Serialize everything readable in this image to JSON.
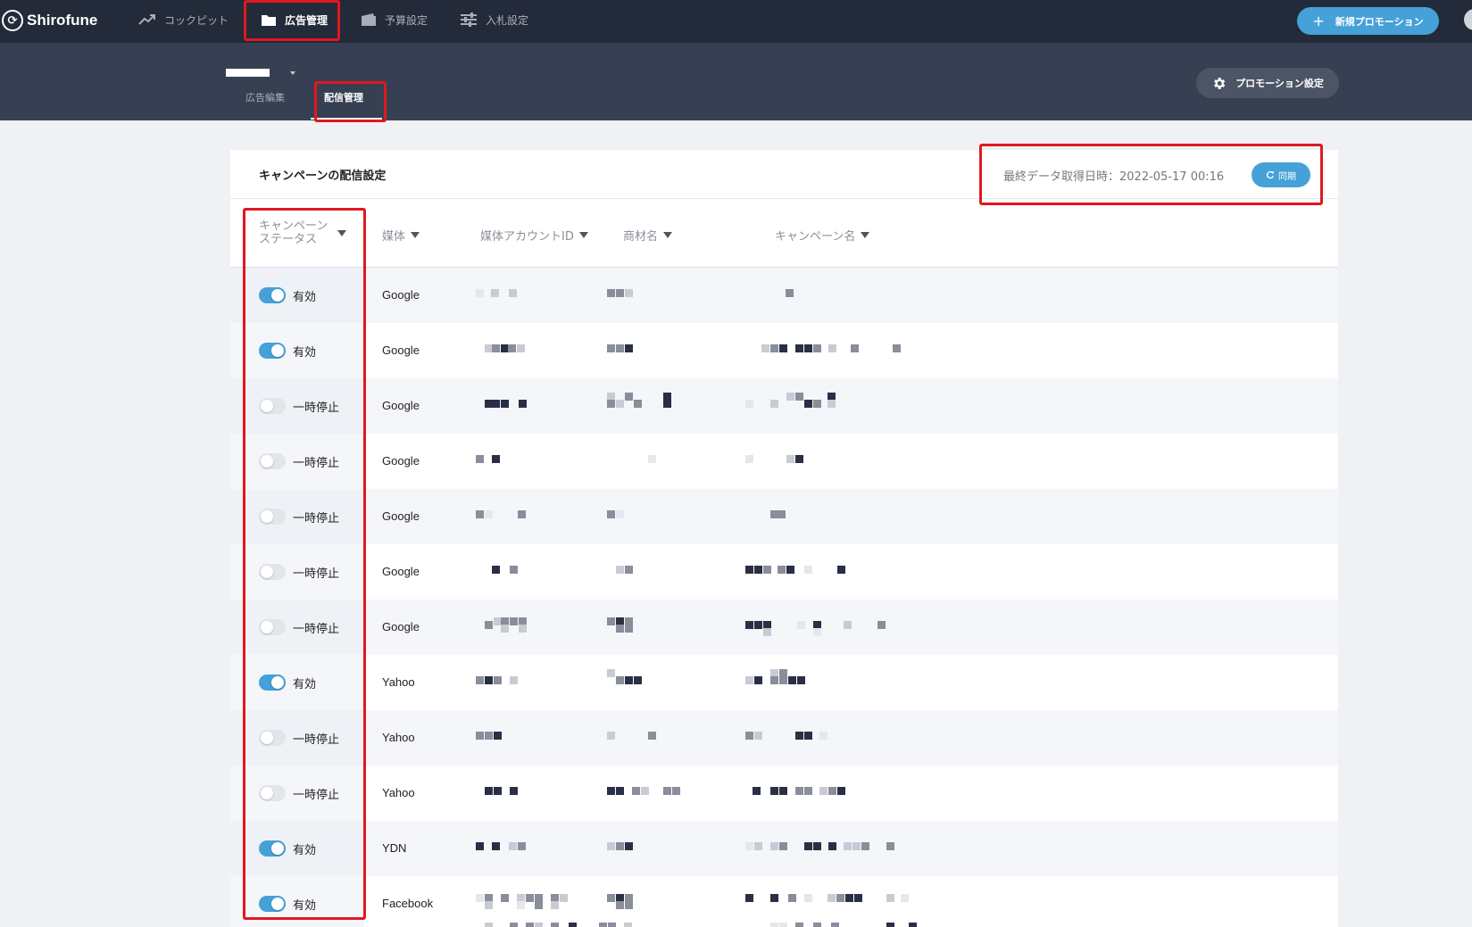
{
  "app": {
    "logo_text": "Shirofune"
  },
  "topnav": {
    "items": [
      {
        "label": "コックピット",
        "icon": "trend-icon"
      },
      {
        "label": "広告管理",
        "icon": "folder-icon",
        "active": true
      },
      {
        "label": "予算設定",
        "icon": "wallet-icon"
      },
      {
        "label": "入札設定",
        "icon": "sliders-icon"
      }
    ],
    "new_promotion": "新規プロモーション"
  },
  "subheader": {
    "tabs": [
      {
        "label": "広告編集"
      },
      {
        "label": "配信管理",
        "active": true
      }
    ],
    "promotion_settings": "プロモーション設定"
  },
  "card": {
    "title": "キャンペーンの配信設定",
    "last_fetch_label": "最終データ取得日時：",
    "last_fetch_value": "2022-05-17 00:16",
    "sync_label": "同期"
  },
  "table": {
    "columns": {
      "status_line1": "キャンペーン",
      "status_line2": "ステータス",
      "media": "媒体",
      "account_id": "媒体アカウントID",
      "product": "商材名",
      "campaign": "キャンペーン名"
    },
    "rows": [
      {
        "status": "有効",
        "on": true,
        "media": "Google"
      },
      {
        "status": "有効",
        "on": true,
        "media": "Google"
      },
      {
        "status": "一時停止",
        "on": false,
        "media": "Google"
      },
      {
        "status": "一時停止",
        "on": false,
        "media": "Google"
      },
      {
        "status": "一時停止",
        "on": false,
        "media": "Google"
      },
      {
        "status": "一時停止",
        "on": false,
        "media": "Google"
      },
      {
        "status": "一時停止",
        "on": false,
        "media": "Google"
      },
      {
        "status": "有効",
        "on": true,
        "media": "Yahoo"
      },
      {
        "status": "一時停止",
        "on": false,
        "media": "Yahoo"
      },
      {
        "status": "一時停止",
        "on": false,
        "media": "Yahoo"
      },
      {
        "status": "有効",
        "on": true,
        "media": "YDN"
      },
      {
        "status": "有効",
        "on": true,
        "media": "Facebook"
      }
    ]
  },
  "colors": {
    "nav_bg": "#232a3a",
    "subheader_bg": "#374052",
    "accent": "#45a1d8",
    "highlight": "#e0181f"
  }
}
